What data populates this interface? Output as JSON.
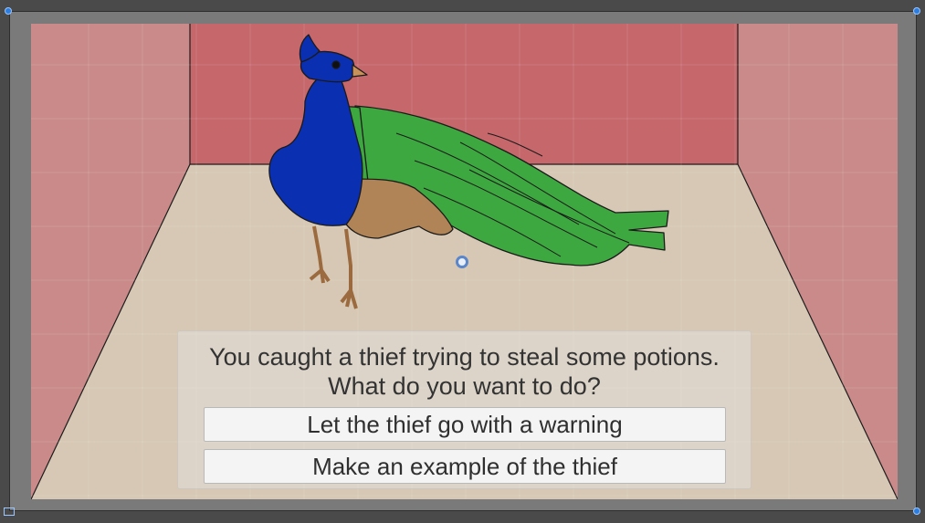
{
  "dialog": {
    "prompt_line1": "You caught a thief trying to steal some potions.",
    "prompt_line2": "What do you want to do?",
    "choices": [
      {
        "label": "Let the thief go with a warning"
      },
      {
        "label": "Make an example of the thief"
      }
    ]
  },
  "scene": {
    "character_icon": "peacock-icon",
    "colors": {
      "back_wall": "#c5676b",
      "side_wall": "#c98a89",
      "floor": "#d6c8b4",
      "peacock_body": "#0a2fb0",
      "peacock_tail": "#3ea840",
      "peacock_wing": "#b08457",
      "selection_handle": "#2c7de0"
    }
  }
}
